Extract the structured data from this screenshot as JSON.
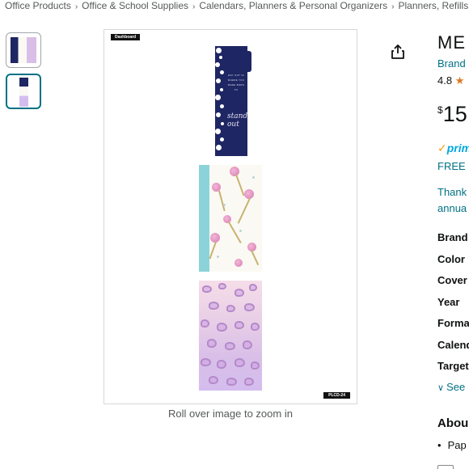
{
  "breadcrumb": [
    "Office Products",
    "Office & School Supplies",
    "Calendars, Planners & Personal Organizers",
    "Planners, Refills"
  ],
  "breadcrumb_separator": "›",
  "gallery": {
    "zoom_note": "Roll over image to zoom in",
    "dashboard_tag": "Dashboard",
    "product_code": "PLCD-24",
    "quote_text": "WAY OUT IN WHERE YOU WERE BORN TO",
    "script_text": "stand out"
  },
  "product": {
    "title": "ME",
    "brand_link": "Brand",
    "rating_value": "4.8",
    "price_symbol": "$",
    "price_whole": "15",
    "prime_label": "prim",
    "free_label": "FREE I",
    "thanks_line1": "Thank",
    "thanks_line2": "annua",
    "specs": [
      "Brand",
      "Color",
      "Cover",
      "Year",
      "Forma",
      "Calend",
      "Target"
    ],
    "see_more": "See",
    "about_heading": "Abou",
    "bullet_1": "Pap"
  },
  "colors": {
    "link": "#007185",
    "star": "#de7921",
    "prime": "#00a8e1",
    "navy_card": "#1e2663"
  },
  "icons": {
    "share": "share-icon",
    "star": "star-icon",
    "chevron": "chevron-down-icon"
  }
}
